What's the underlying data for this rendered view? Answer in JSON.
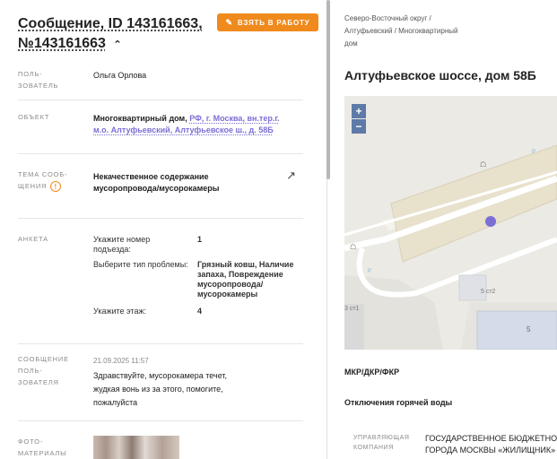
{
  "header": {
    "title_line1": "Сообщение, ID 143161663,",
    "title_line2": "№143161663",
    "take_button": "ВЗЯТЬ В РАБОТУ"
  },
  "fields": {
    "user": {
      "label_1": "ПОЛЬ-",
      "label_2": "ЗОВАТЕЛЬ",
      "value": "Ольга Орлова"
    },
    "object": {
      "label": "ОБЪЕКТ",
      "value_prefix": "Многоквартирный дом, ",
      "value_link_1": "РФ, г. Москва, вн.тер.г.",
      "value_link_2": "м.о. Алтуфьевский, Алтуфьевское ш., д. 58Б"
    },
    "topic": {
      "label_1": "ТЕМА СООБ-",
      "label_2": "ЩЕНИЯ",
      "value_1": "Некачественное содержание",
      "value_2": "мусоропровода/мусорокамеры"
    },
    "survey": {
      "label": "АНКЕТА",
      "items": [
        {
          "q1": "Укажите номер",
          "q2": "подъезда:",
          "a1": "1"
        },
        {
          "q1": "Выберите тип проблемы:",
          "a1": "Грязный ковш, Наличие",
          "a2": "запаха, Повреждение",
          "a3": "мусоропровода/",
          "a4": "мусорокамеры"
        },
        {
          "q1": "Укажите этаж:",
          "a1": "4"
        }
      ]
    },
    "message": {
      "label_1": "СООБЩЕНИЕ",
      "label_2": "ПОЛЬ-",
      "label_3": "ЗОВАТЕЛЯ",
      "date": "21.09.2025 11:57",
      "text_1": "Здравствуйте, мусорокамера течет,",
      "text_2": "жудкая вонь из за этого, помогите,",
      "text_3": "пожалуйста"
    },
    "photos": {
      "label_1": "ФОТО-",
      "label_2": "МАТЕРИАЛЫ"
    }
  },
  "right": {
    "breadcrumb_1": "Северо-Восточный округ /",
    "breadcrumb_2": "Алтуфьевский / Многоквартирный",
    "breadcrumb_3": "дом",
    "address": "Алтуфьевское шоссе, дом 58Б",
    "map": {
      "zoom_in": "+",
      "zoom_out": "−",
      "label_building_1": "5 ст2",
      "label_building_2": "3 ст1",
      "label_building_3": "5",
      "label_p1": "P",
      "label_p2": "P",
      "marker_color": "#7b6fd6"
    },
    "section_1": "МКР/ДКР/ФКР",
    "section_2": "Отключения горячей воды",
    "uk_label_1": "УПРАВЛЯЮЩАЯ",
    "uk_label_2": "КОМПАНИЯ",
    "uk_value_1": "ГОСУДАРСТВЕННОЕ БЮДЖЕТНОЕ",
    "uk_value_2": "ГОРОДА МОСКВЫ «ЖИЛИЩНИК»"
  }
}
